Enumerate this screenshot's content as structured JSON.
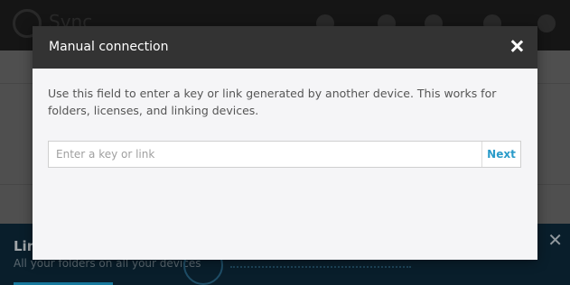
{
  "app": {
    "title": "Sync"
  },
  "banner": {
    "title": "Lin",
    "subtitle": "All your folders on all your devices"
  },
  "dialog": {
    "title": "Manual connection",
    "description": "Use this field to enter a key or link generated by another device. This works for folders, licenses, and linking devices.",
    "input_placeholder": "Enter a key or link",
    "input_value": "",
    "next_label": "Next"
  },
  "colors": {
    "header_bg": "#333333",
    "accent": "#2a9bc9",
    "dialog_bg": "#f5f5f7",
    "banner_bg": "#0d2a3c"
  }
}
